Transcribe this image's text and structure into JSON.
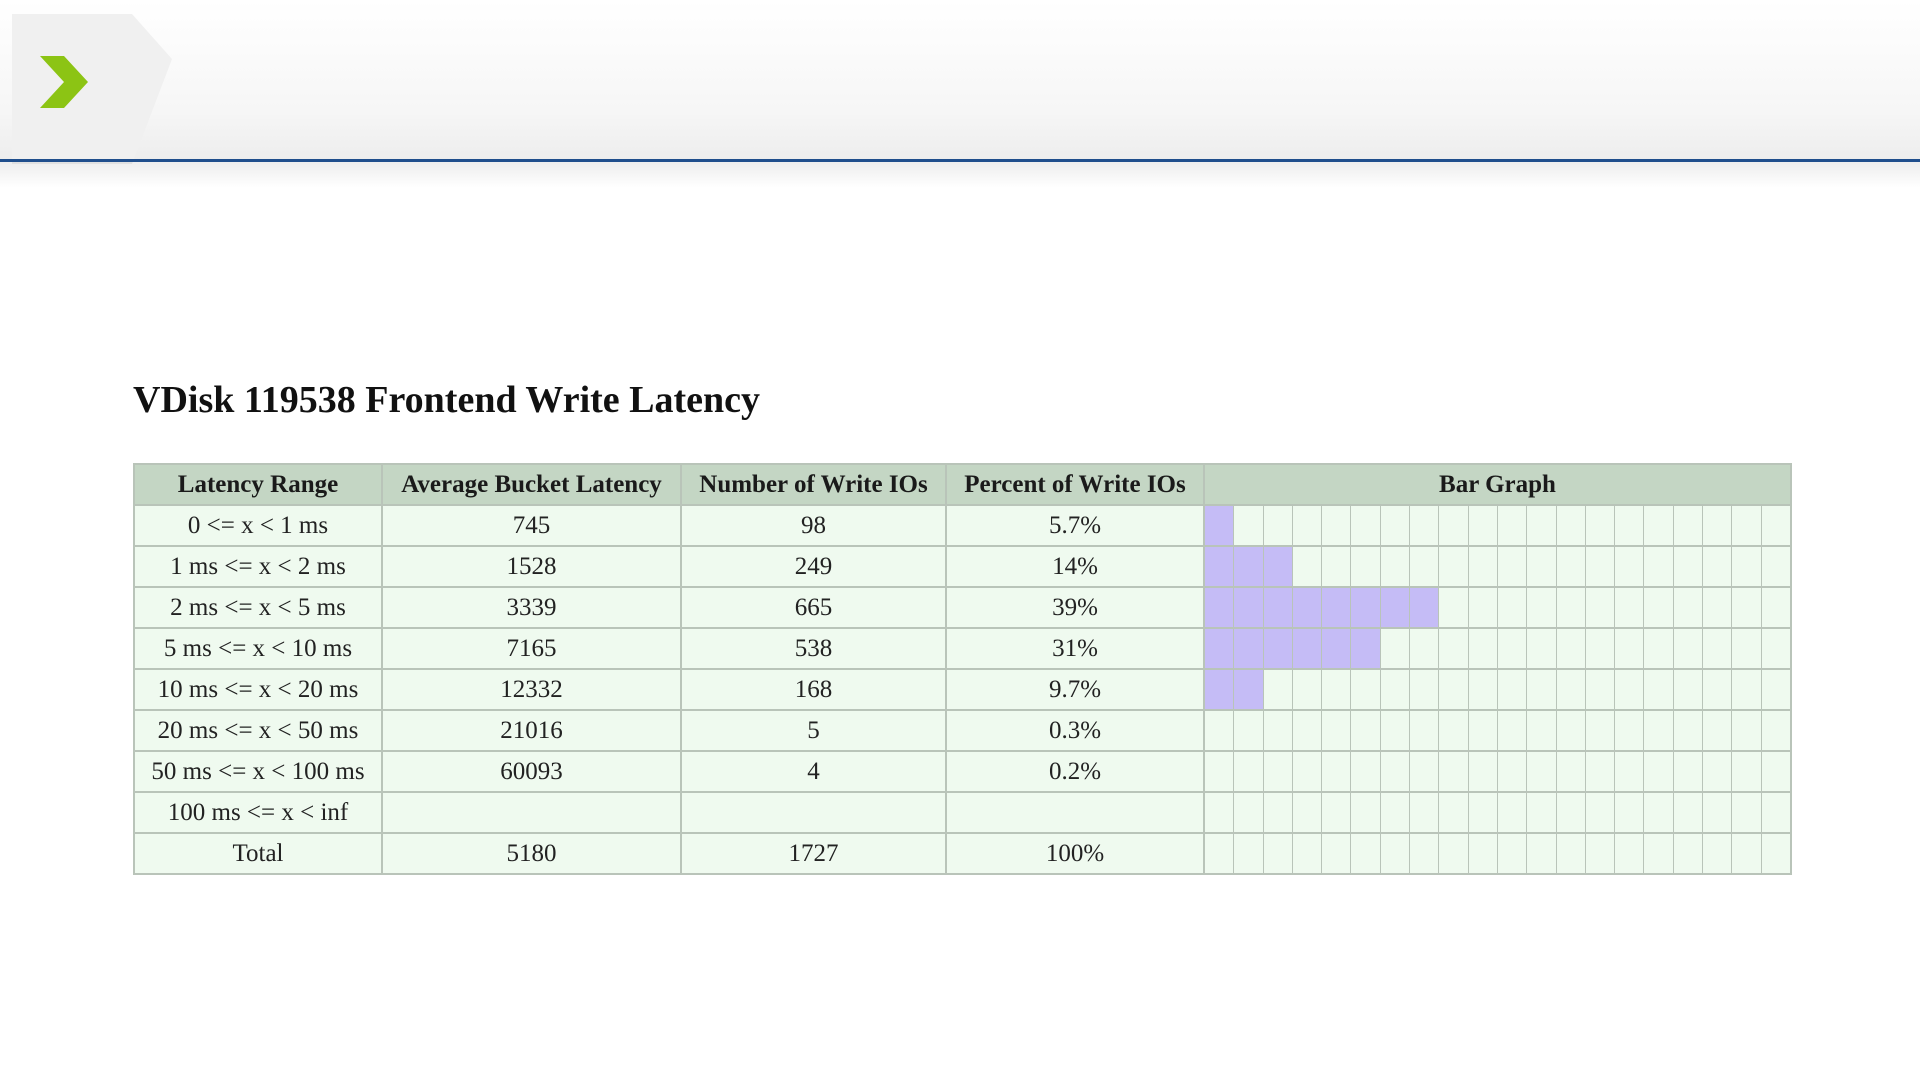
{
  "page": {
    "title": "VDisk 119538 Frontend Write Latency"
  },
  "colors": {
    "header_rule": "#1f4e8c",
    "chevron": "#8cc414",
    "table_header_bg": "#c4d6c4",
    "table_cell_bg": "#effaef",
    "bar_fill": "#c5bcf6"
  },
  "table": {
    "headers": [
      "Latency Range",
      "Average Bucket Latency",
      "Number of Write IOs",
      "Percent of Write IOs",
      "Bar Graph"
    ],
    "bar_graph_cells": 20,
    "rows": [
      {
        "range": "0 <= x < 1 ms",
        "avg": "745",
        "count": "98",
        "percent": "5.7%",
        "bar": 1
      },
      {
        "range": "1 ms <= x < 2 ms",
        "avg": "1528",
        "count": "249",
        "percent": "14%",
        "bar": 3
      },
      {
        "range": "2 ms <= x < 5 ms",
        "avg": "3339",
        "count": "665",
        "percent": "39%",
        "bar": 8
      },
      {
        "range": "5 ms <= x < 10 ms",
        "avg": "7165",
        "count": "538",
        "percent": "31%",
        "bar": 6
      },
      {
        "range": "10 ms <= x < 20 ms",
        "avg": "12332",
        "count": "168",
        "percent": "9.7%",
        "bar": 2
      },
      {
        "range": "20 ms <= x < 50 ms",
        "avg": "21016",
        "count": "5",
        "percent": "0.3%",
        "bar": 0
      },
      {
        "range": "50 ms <= x < 100 ms",
        "avg": "60093",
        "count": "4",
        "percent": "0.2%",
        "bar": 0
      },
      {
        "range": "100 ms <= x < inf",
        "avg": "",
        "count": "",
        "percent": "",
        "bar": 0
      },
      {
        "range": "Total",
        "avg": "5180",
        "count": "1727",
        "percent": "100%",
        "bar": 0
      }
    ]
  }
}
